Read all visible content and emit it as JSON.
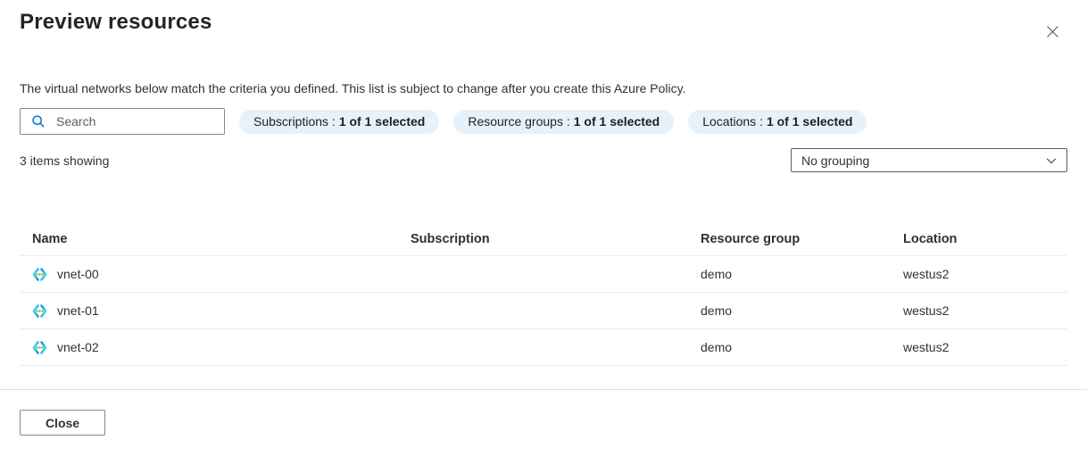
{
  "panel": {
    "title": "Preview resources",
    "description": "The virtual networks below match the criteria you defined. This list is subject to change after you create this Azure Policy."
  },
  "toolbar": {
    "search": {
      "placeholder": "Search",
      "value": ""
    },
    "filters": [
      {
        "label": "Subscriptions :",
        "value": "1 of 1 selected"
      },
      {
        "label": "Resource groups :",
        "value": "1 of 1 selected"
      },
      {
        "label": "Locations :",
        "value": "1 of 1 selected"
      }
    ],
    "items_count_text": "3 items showing",
    "grouping": {
      "selected": "No grouping"
    }
  },
  "table": {
    "columns": [
      "Name",
      "Subscription",
      "Resource group",
      "Location"
    ],
    "rows": [
      {
        "icon": "virtual-network-icon",
        "name": "vnet-00",
        "subscription": "",
        "resource_group": "demo",
        "location": "westus2"
      },
      {
        "icon": "virtual-network-icon",
        "name": "vnet-01",
        "subscription": "",
        "resource_group": "demo",
        "location": "westus2"
      },
      {
        "icon": "virtual-network-icon",
        "name": "vnet-02",
        "subscription": "",
        "resource_group": "demo",
        "location": "westus2"
      }
    ]
  },
  "footer": {
    "close_label": "Close"
  },
  "colors": {
    "accent": "#0078d4",
    "pill_background": "#e6f2fb",
    "divider": "#edebe9",
    "vnet_icon_cyan": "#50e6ff",
    "vnet_icon_blue": "#1490df",
    "vnet_icon_green": "#76bc2d",
    "text_primary": "#323130",
    "text_secondary": "#605e5c"
  }
}
